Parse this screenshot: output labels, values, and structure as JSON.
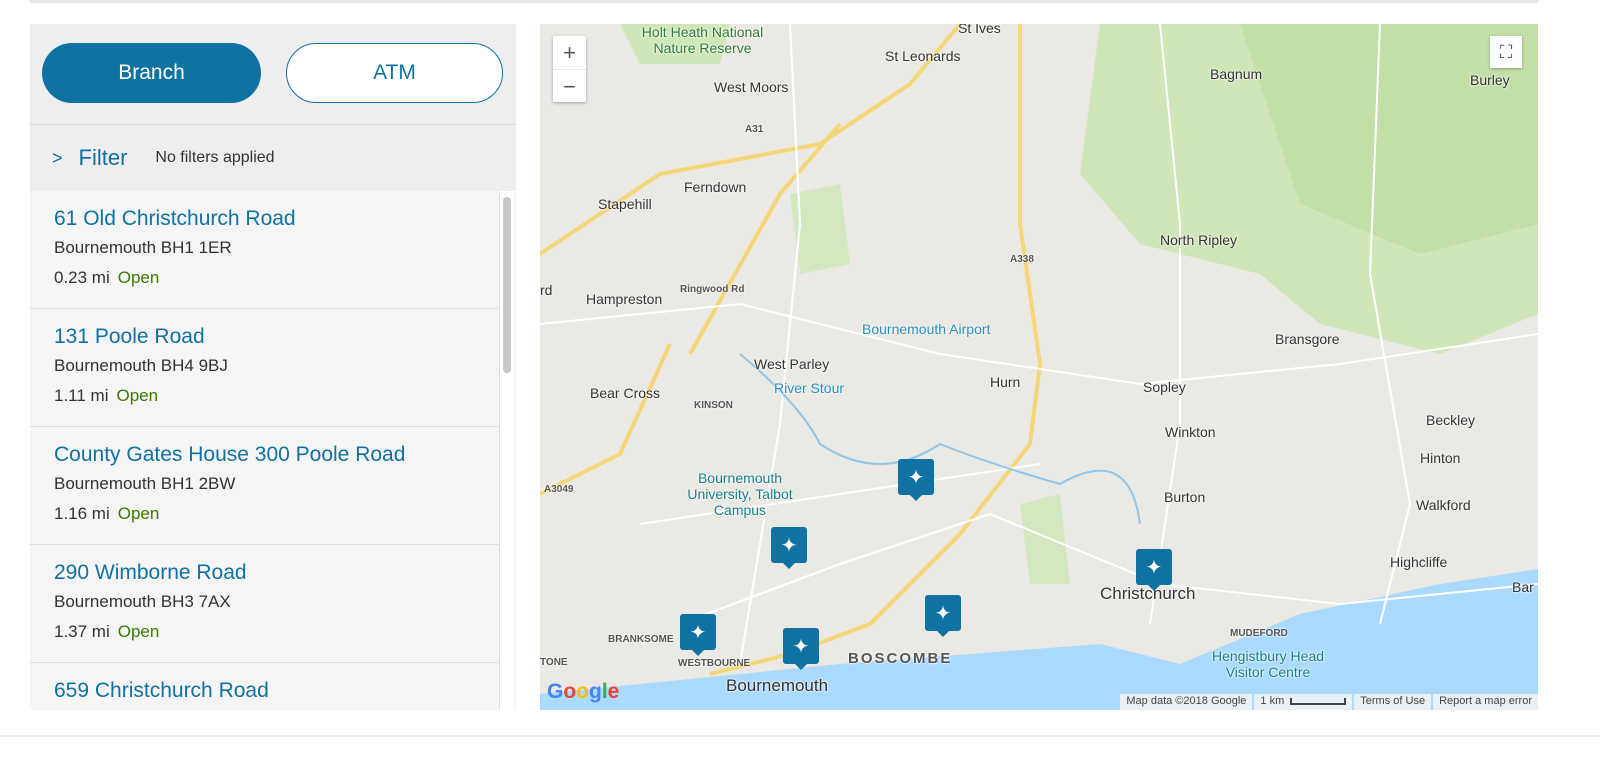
{
  "tabs": {
    "branch": "Branch",
    "atm": "ATM"
  },
  "filter": {
    "label": "Filter",
    "note": "No filters applied"
  },
  "branches": [
    {
      "name": "61 Old Christchurch Road",
      "city": "Bournemouth BH1 1ER",
      "distance": "0.23 mi",
      "status": "Open"
    },
    {
      "name": "131 Poole Road",
      "city": "Bournemouth BH4 9BJ",
      "distance": "1.11 mi",
      "status": "Open"
    },
    {
      "name": "County Gates House 300 Poole Road",
      "city": "Bournemouth BH1 2BW",
      "distance": "1.16 mi",
      "status": "Open"
    },
    {
      "name": "290 Wimborne Road",
      "city": "Bournemouth BH3 7AX",
      "distance": "1.37 mi",
      "status": "Open"
    },
    {
      "name": "659 Christchurch Road",
      "city": "",
      "distance": "",
      "status": ""
    }
  ],
  "map": {
    "zoom_in": "+",
    "zoom_out": "−",
    "fullscreen": "⛶",
    "logo": "Google",
    "labels": [
      "Holt Heath National Nature Reserve",
      "St Ives",
      "St Leonards",
      "West Moors",
      "Bagnum",
      "Burley",
      "Ferndown",
      "Stapehill",
      "North Ripley",
      "Hampreston",
      "Bournemouth Airport",
      "West Parley",
      "Hurn",
      "Bransgore",
      "Sopley",
      "Bear Cross",
      "KINSON",
      "River Stour",
      "Winkton",
      "Beckley",
      "Hinton",
      "Bournemouth University, Talbot Campus",
      "Burton",
      "Walkford",
      "Highcliffe",
      "Christchurch",
      "BRANKSOME",
      "WESTBOURNE",
      "BOSCOMBE",
      "Bournemouth",
      "MUDEFORD",
      "Hengistbury Head Visitor Centre",
      "A31",
      "A338",
      "A3049",
      "Ringwood Rd",
      "Bar",
      "TONE",
      "rd"
    ],
    "attribution": {
      "data": "Map data ©2018 Google",
      "scale": "1 km",
      "terms": "Terms of Use",
      "report": "Report a map error"
    }
  },
  "colors": {
    "brand": "#0f72a3",
    "open": "#3b7a00"
  }
}
